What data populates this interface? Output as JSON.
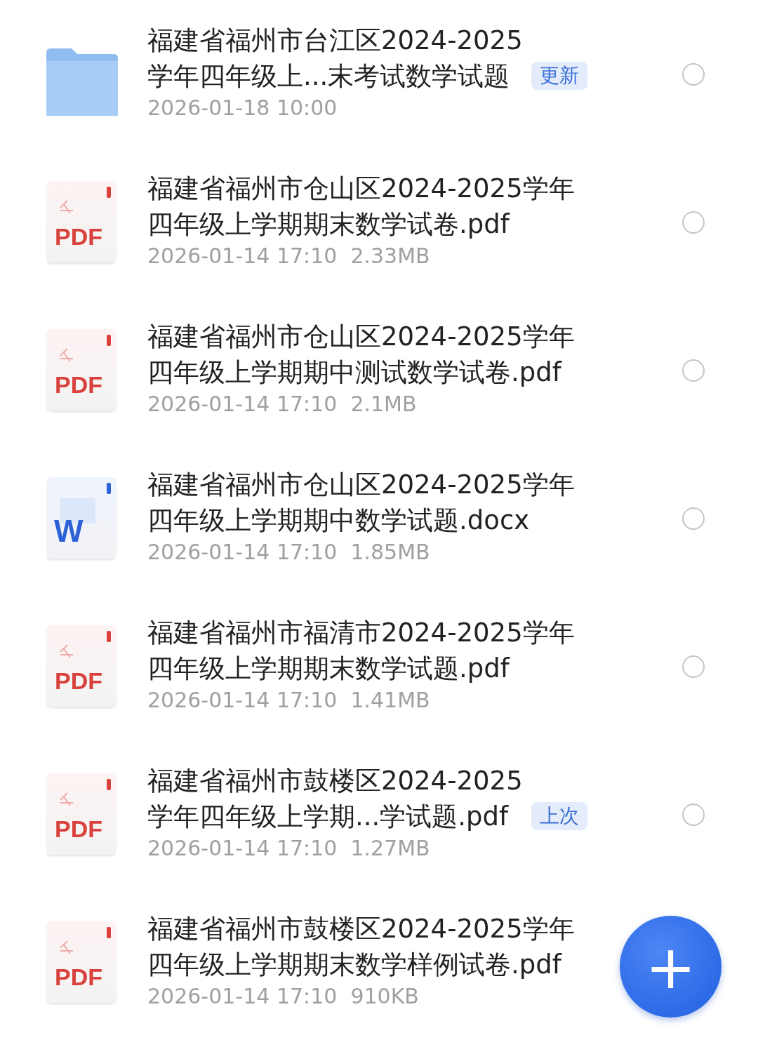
{
  "files": [
    {
      "kind": "folder",
      "name_lines": [
        "福建省福州市台江区2024-2025",
        "学年四年级上...末考试数学试题"
      ],
      "badge": "更新",
      "meta": "2026-01-18 10:00",
      "selected": false
    },
    {
      "kind": "pdf",
      "icon_text": "PDF",
      "name_lines": [
        "福建省福州市仓山区2024-2025学年",
        "四年级上学期期末数学试卷.pdf"
      ],
      "meta": "2026-01-14 17:10  2.33MB",
      "selected": false
    },
    {
      "kind": "pdf",
      "icon_text": "PDF",
      "name_lines": [
        "福建省福州市仓山区2024-2025学年",
        "四年级上学期期中测试数学试卷.pdf"
      ],
      "meta": "2026-01-14 17:10  2.1MB",
      "selected": false
    },
    {
      "kind": "word",
      "icon_text": "W",
      "name_lines": [
        "福建省福州市仓山区2024-2025学年",
        "四年级上学期期中数学试题.docx"
      ],
      "meta": "2026-01-14 17:10  1.85MB",
      "selected": false
    },
    {
      "kind": "pdf",
      "icon_text": "PDF",
      "name_lines": [
        "福建省福州市福清市2024-2025学年",
        "四年级上学期期末数学试题.pdf"
      ],
      "meta": "2026-01-14 17:10  1.41MB",
      "selected": false
    },
    {
      "kind": "pdf",
      "icon_text": "PDF",
      "name_lines": [
        "福建省福州市鼓楼区2024-2025",
        "学年四年级上学期...学试题.pdf"
      ],
      "badge": "上次",
      "meta": "2026-01-14 17:10  1.27MB",
      "selected": false
    },
    {
      "kind": "pdf",
      "icon_text": "PDF",
      "name_lines": [
        "福建省福州市鼓楼区2024-2025学年",
        "四年级上学期期末数学样例试卷.pdf"
      ],
      "meta": "2026-01-14 17:10  910KB"
    }
  ],
  "fab": {
    "label": "+"
  }
}
